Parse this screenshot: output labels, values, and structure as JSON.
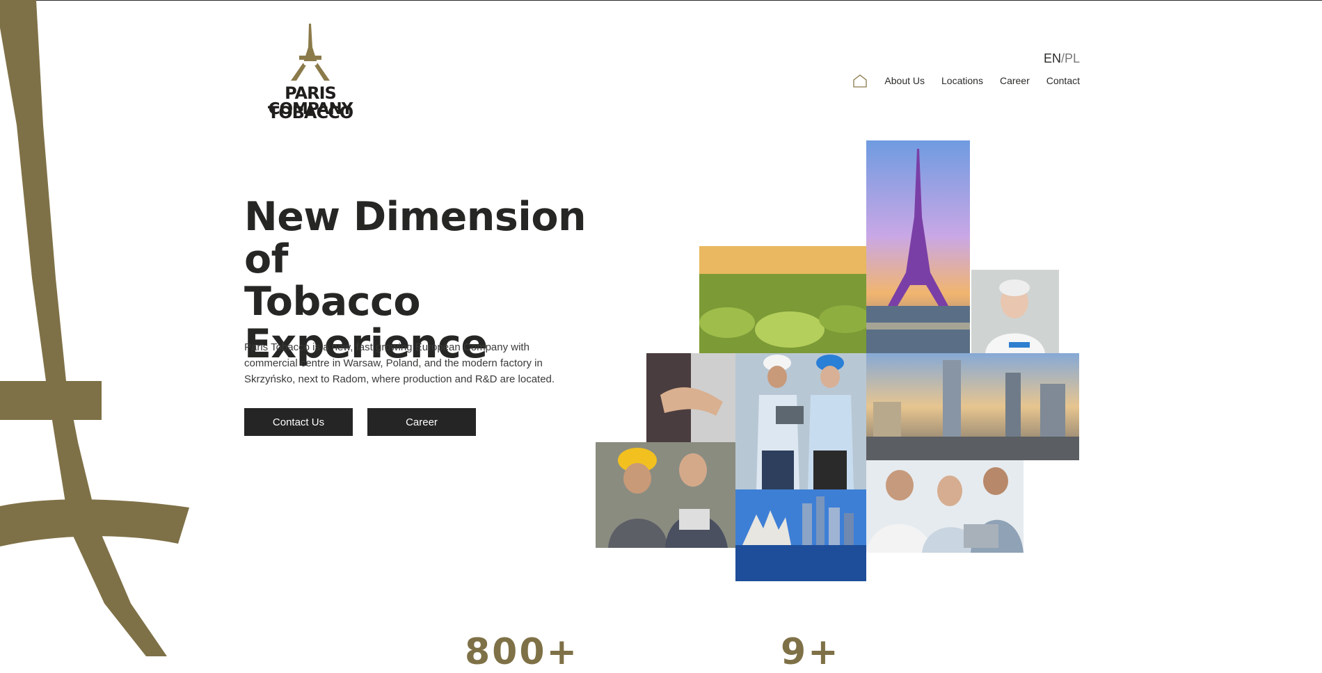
{
  "brand": {
    "name_line1": "PARIS TOBACCO",
    "name_line2": "COMPANY",
    "accent": "#7f7147",
    "dark": "#252525"
  },
  "lang": {
    "current": "EN",
    "separator": "/",
    "other": "PL"
  },
  "nav": {
    "home_icon": "home-icon",
    "items": [
      "About Us",
      "Locations",
      "Career",
      "Contact"
    ]
  },
  "hero": {
    "title_line1": "New Dimension of",
    "title_line2": "Tobacco",
    "title_line3": "Experience",
    "description": "Paris Tobacco is a new, fast growing European Company with commercial centre in Warsaw, Poland, and the modern factory in Skrzyńsko, next to Radom, where production and R&D are located.",
    "buttons": {
      "contact": "Contact Us",
      "career": "Career"
    }
  },
  "gallery": [
    "eiffel-tower-photo",
    "tobacco-field-photo",
    "lab-worker-photo",
    "handshake-photo",
    "engineers-photo",
    "warsaw-skyline-photo",
    "hardhat-workers-photo",
    "singapore-skyline-photo",
    "office-team-photo"
  ],
  "stats": [
    "800+",
    "9+"
  ]
}
